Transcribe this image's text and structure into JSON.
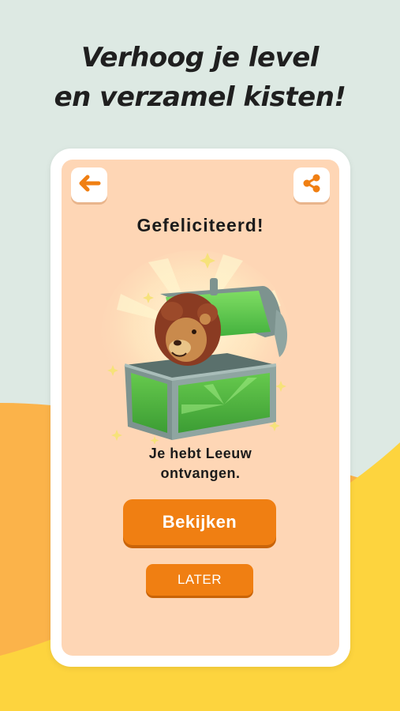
{
  "headline": {
    "line1": "Verhoog je level",
    "line2": "en verzamel kisten!"
  },
  "dialog": {
    "title": "Gefeliciteerd!",
    "message_line1": "Je hebt Leeuw",
    "message_line2": "ontvangen.",
    "primary_label": "Bekijken",
    "secondary_label": "LATER"
  },
  "icons": {
    "back": "arrow-left-icon",
    "share": "share-icon",
    "reward": "lion-treasure-chest-icon"
  },
  "colors": {
    "accent": "#f07f12",
    "card_background": "#fed6b5",
    "page_background": "#dde9e3",
    "wave_orange": "#fbb34a",
    "wave_yellow": "#fdd43e"
  }
}
